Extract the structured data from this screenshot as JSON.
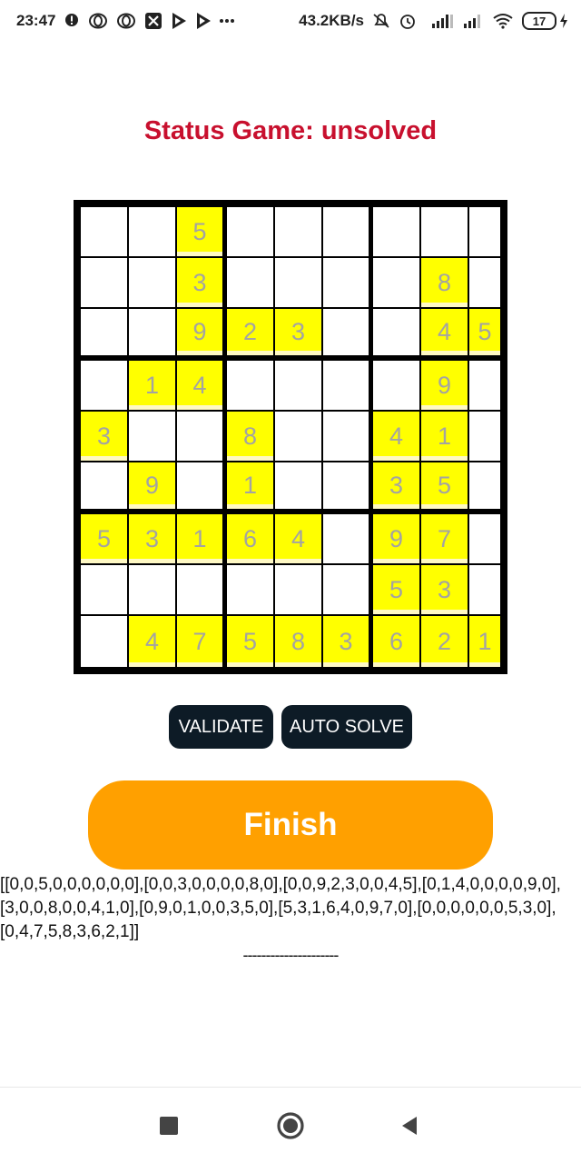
{
  "status_bar": {
    "time": "23:47",
    "net_speed": "43.2KB/s",
    "battery": "17"
  },
  "status": {
    "text": "Status Game: unsolved"
  },
  "board": [
    [
      0,
      0,
      5,
      0,
      0,
      0,
      0,
      0,
      0
    ],
    [
      0,
      0,
      3,
      0,
      0,
      0,
      0,
      8,
      0
    ],
    [
      0,
      0,
      9,
      2,
      3,
      0,
      0,
      4,
      5
    ],
    [
      0,
      1,
      4,
      0,
      0,
      0,
      0,
      9,
      0
    ],
    [
      3,
      0,
      0,
      8,
      0,
      0,
      4,
      1,
      0
    ],
    [
      0,
      9,
      0,
      1,
      0,
      0,
      3,
      5,
      0
    ],
    [
      5,
      3,
      1,
      6,
      4,
      0,
      9,
      7,
      0
    ],
    [
      0,
      0,
      0,
      0,
      0,
      0,
      5,
      3,
      0
    ],
    [
      0,
      4,
      7,
      5,
      8,
      3,
      6,
      2,
      1
    ]
  ],
  "colors": {
    "filled_cell": "#ffff00",
    "status_text": "#c8102e",
    "finish_button": "#ffa000",
    "dark_button": "#0d1b26"
  },
  "buttons": {
    "validate": "VALIDATE",
    "auto_solve": "AUTO SOLVE",
    "finish": "Finish"
  },
  "board_text": "[[0,0,5,0,0,0,0,0,0],[0,0,3,0,0,0,0,8,0],[0,0,9,2,3,0,0,4,5],[0,1,4,0,0,0,0,9,0],[3,0,0,8,0,0,4,1,0],[0,9,0,1,0,0,3,5,0],[5,3,1,6,4,0,9,7,0],[0,0,0,0,0,0,5,3,0],[0,4,7,5,8,3,6,2,1]]",
  "divider_text": "---------------------",
  "nav": {
    "icons": [
      "recent-apps-icon",
      "home-icon",
      "back-icon"
    ]
  }
}
